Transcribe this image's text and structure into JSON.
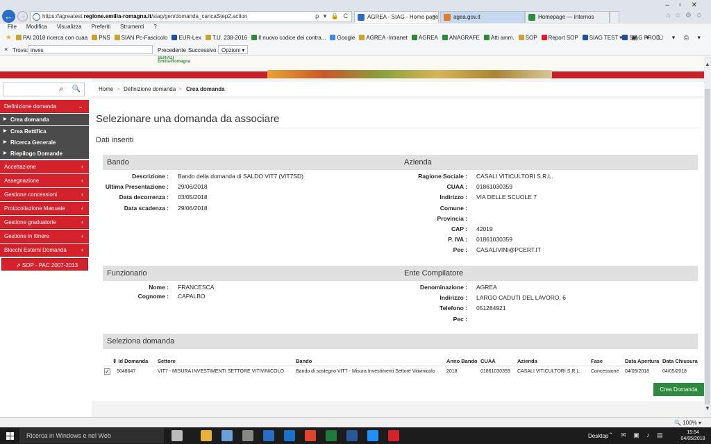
{
  "browser": {
    "url_prefix": "https://agreatest.",
    "url_domain": "regione.emilia-romagna.it",
    "url_path": "/siag/gen/domanda_caricaStep2.action",
    "addr_controls": "ρ ▾ 🔒 C",
    "tabs": [
      {
        "label": "AGREA - SIAG - Home page",
        "close": "×",
        "color": "#2a6dc4"
      },
      {
        "label": "agea.gov.it",
        "close": "",
        "color": "#e07b2a"
      },
      {
        "label": "Homepage — Internos",
        "close": "",
        "color": "#2f8a3d"
      }
    ],
    "window_controls": "–▫✕",
    "toolbar_icons": "⌂☆⚙☺"
  },
  "menu": [
    "File",
    "Modifica",
    "Visualizza",
    "Preferiti",
    "Strumenti",
    "?"
  ],
  "favorites": [
    {
      "label": "PAI 2018 ricerca con cuaa",
      "color": "#c9a431"
    },
    {
      "label": "PNS",
      "color": "#c9a431"
    },
    {
      "label": "SIAN Pc-Fascicolo",
      "color": "#c9a431"
    },
    {
      "label": "EUR-Lex",
      "color": "#1f4fa0"
    },
    {
      "label": "T.U. 238-2016",
      "color": "#c9a431"
    },
    {
      "label": "Il nuovo codice dei contra...",
      "color": "#2f8a3d"
    },
    {
      "label": "Google",
      "color": "#4285f4"
    },
    {
      "label": "AGREA -Intranet",
      "color": "#c9a431"
    },
    {
      "label": "AGREA",
      "color": "#2f8a3d"
    },
    {
      "label": "ANAGRAFE",
      "color": "#2f8a3d"
    },
    {
      "label": "Atti amm.",
      "color": "#2f8a3d"
    },
    {
      "label": "SOP",
      "color": "#c9a431"
    },
    {
      "label": "Report SOP",
      "color": "#d4222d"
    },
    {
      "label": "SIAG TEST",
      "color": "#1f4fa0"
    },
    {
      "label": "SIAG PROD.",
      "color": "#1f4fa0"
    }
  ],
  "fav_tools": "▾ ▣ ▾ ☐ ▾ ⎙ ▾",
  "findbar": {
    "close": "×",
    "label": "Trova:",
    "value": "inves",
    "prev": "Precedente",
    "next": "Successivo",
    "options": "Opzioni ▾"
  },
  "logo": {
    "line1": "SERVIZI",
    "line2": "Emilia-Romagna"
  },
  "sidebar": {
    "search_icon": "⌕",
    "zoom_icon": "🔍",
    "sections": [
      {
        "label": "Definizione domanda",
        "chev": "⌄"
      },
      {
        "label": "Accettazione",
        "chev": "‹"
      },
      {
        "label": "Assegnazione",
        "chev": "‹"
      },
      {
        "label": "Gestione concessioni",
        "chev": "‹"
      },
      {
        "label": "Protocollazione Manuale",
        "chev": "‹"
      },
      {
        "label": "Gestione graduatorie",
        "chev": "‹"
      },
      {
        "label": "Gestione in Itinere",
        "chev": "‹"
      },
      {
        "label": "Blocchi Esterni Domanda",
        "chev": "‹"
      }
    ],
    "subitems": [
      "Crea domanda",
      "Crea Rettifica",
      "Ricerca Generale",
      "Riepilogo Domande"
    ],
    "sop_button": "⇗  SOP - PAC 2007-2013"
  },
  "breadcrumb": [
    "Home",
    ">",
    "Definizione domanda",
    ">",
    "Crea domanda"
  ],
  "page_title": "Selezionare una domanda da associare",
  "section_title": "Dati inseriti",
  "bando": {
    "header": "Bando",
    "rows": [
      {
        "label": "Descrizione :",
        "value": "Bando della domanda di SALDO VIT7 (VIT7SD)"
      },
      {
        "label": "Ultima Presentazione :",
        "value": "29/06/2018"
      },
      {
        "label": "Data decorrenza :",
        "value": "03/05/2018"
      },
      {
        "label": "Data scadenza :",
        "value": "29/06/2018"
      }
    ]
  },
  "azienda": {
    "header": "Azienda",
    "rows": [
      {
        "label": "Ragione Sociale :",
        "value": "CASALI VITICULTORI S.R.L."
      },
      {
        "label": "CUAA :",
        "value": "01861030359"
      },
      {
        "label": "Indirizzo :",
        "value": "VIA DELLE SCUOLE 7"
      },
      {
        "label": "Comune :",
        "value": ""
      },
      {
        "label": "Provincia :",
        "value": ""
      },
      {
        "label": "CAP :",
        "value": "42019"
      },
      {
        "label": "P. IVA :",
        "value": "01861030359"
      },
      {
        "label": "Pec :",
        "value": "CASALIVINI@PCERT.IT"
      }
    ]
  },
  "funzionario": {
    "header": "Funzionario",
    "rows": [
      {
        "label": "Nome :",
        "value": "FRANCESCA"
      },
      {
        "label": "Cognome :",
        "value": "CAPALBO"
      }
    ]
  },
  "ente": {
    "header": "Ente Compilatore",
    "rows": [
      {
        "label": "Denominazione :",
        "value": "AGREA"
      },
      {
        "label": "Indirizzo :",
        "value": "LARGO CADUTI DEL LAVORO, 6"
      },
      {
        "label": "Telefono :",
        "value": "051284921"
      },
      {
        "label": "Pec :",
        "value": ""
      }
    ]
  },
  "seleziona": {
    "header": "Seleziona domanda",
    "columns": [
      "⇕ Id Domanda",
      "Settore",
      "Bando",
      "Anno Bando",
      "CUAA",
      "Azienda",
      "Fase",
      "Data Apertura",
      "Data Chiusura"
    ],
    "rows": [
      [
        "5048647",
        "VIT7 - MISURA INVESTIMENTI SETTORE VITIVINICOLO",
        "Bando di sostegno VIT7 - Misura Investimenti Settore Vitivinicolo",
        "2018",
        "01861030359",
        "CASALI VITICULTORI S.R.L.",
        "Concessione",
        "04/05/2018",
        "04/05/2018"
      ]
    ],
    "checked": "✓",
    "button": "Crea Domanda"
  },
  "status": {
    "zoom": "🔍 100% ▾"
  },
  "taskbar": {
    "search": "Ricerca in Windows e nel Web",
    "desktop": "Desktop",
    "tray": "⌃ ✉ ▣ ♪ ▤",
    "time": "15:54",
    "date": "04/05/2018",
    "icon_colors": [
      "#bbb",
      "#e8b23a",
      "#6aa0d8",
      "#888",
      "#2a6dc4",
      "#1a73c8",
      "#e0452c",
      "#1d7a3c",
      "#2b5797",
      "#1e90ff",
      "#d4222d"
    ]
  }
}
